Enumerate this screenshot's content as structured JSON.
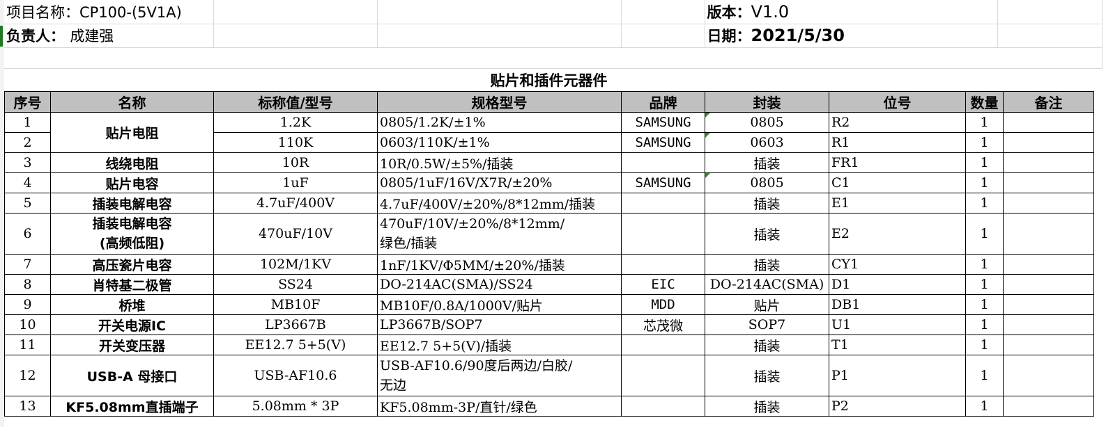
{
  "project": {
    "label": "项目名称：CP100-(5V1A)",
    "version_label": "版本：",
    "version": "V1.0"
  },
  "owner": {
    "label": "负责人：",
    "name": "成建强",
    "date_label": "日期：",
    "date": "2021/5/30"
  },
  "table_title": "贴片和插件元器件",
  "headers": [
    "序号",
    "名称",
    "标称值/型号",
    "规格型号",
    "品牌",
    "封装",
    "位号",
    "数量",
    "备注"
  ],
  "rows": [
    {
      "no": "1",
      "name": "贴片电阻",
      "value": "1.2K",
      "spec": "0805/1.2K/±1%",
      "brand": "SAMSUNG",
      "package": "0805",
      "ref": "R2",
      "qty": "1",
      "note": ""
    },
    {
      "no": "2",
      "name": "",
      "value": "110K",
      "spec": "0603/110K/±1%",
      "brand": "SAMSUNG",
      "package": "0603",
      "ref": "R1",
      "qty": "1",
      "note": ""
    },
    {
      "no": "3",
      "name": "线绕电阻",
      "value": "10R",
      "spec": "10R/0.5W/±5%/插装",
      "brand": "",
      "package": "插装",
      "ref": "FR1",
      "qty": "1",
      "note": ""
    },
    {
      "no": "4",
      "name": "贴片电容",
      "value": "1uF",
      "spec": "0805/1uF/16V/X7R/±20%",
      "brand": "SAMSUNG",
      "package": "0805",
      "ref": "C1",
      "qty": "1",
      "note": ""
    },
    {
      "no": "5",
      "name": "插装电解电容",
      "value": "4.7uF/400V",
      "spec": "4.7uF/400V/±20%/8*12mm/插装",
      "brand": "",
      "package": "插装",
      "ref": "E1",
      "qty": "1",
      "note": ""
    },
    {
      "no": "6",
      "name": "插装电解电容",
      "name2": "(高频低阻)",
      "value": "470uF/10V",
      "spec": "470uF/10V/±20%/8*12mm/",
      "spec2": "绿色/插装",
      "brand": "",
      "package": "插装",
      "ref": "E2",
      "qty": "1",
      "note": ""
    },
    {
      "no": "7",
      "name": "高压瓷片电容",
      "value": "102M/1KV",
      "spec": "1nF/1KV/Φ5MM/±20%/插装",
      "brand": "",
      "package": "插装",
      "ref": "CY1",
      "qty": "1",
      "note": ""
    },
    {
      "no": "8",
      "name": "肖特基二极管",
      "value": "SS24",
      "spec": "DO-214AC(SMA)/SS24",
      "brand": "EIC",
      "package": "DO-214AC(SMA)",
      "ref": "D1",
      "qty": "1",
      "note": ""
    },
    {
      "no": "9",
      "name": "桥堆",
      "value": "MB10F",
      "spec": "MB10F/0.8A/1000V/贴片",
      "brand": "MDD",
      "package": "贴片",
      "ref": "DB1",
      "qty": "1",
      "note": ""
    },
    {
      "no": "10",
      "name": "开关电源IC",
      "value": "LP3667B",
      "spec": "LP3667B/SOP7",
      "brand": "芯茂微",
      "package": "SOP7",
      "ref": "U1",
      "qty": "1",
      "note": ""
    },
    {
      "no": "11",
      "name": "开关变压器",
      "value": "EE12.7 5+5(V)",
      "spec": "EE12.7 5+5(V)/插装",
      "brand": "",
      "package": "插装",
      "ref": "T1",
      "qty": "1",
      "note": ""
    },
    {
      "no": "12",
      "name": "USB-A 母接口",
      "value": "USB-AF10.6",
      "spec": "USB-AF10.6/90度后两边/白胶/",
      "spec2": "无边",
      "brand": "",
      "package": "插装",
      "ref": "P1",
      "qty": "1",
      "note": ""
    },
    {
      "no": "13",
      "name": "KF5.08mm直插端子",
      "value": "5.08mm * 3P",
      "spec": "KF5.08mm-3P/直针/绿色",
      "brand": "",
      "package": "插装",
      "ref": "P2",
      "qty": "1",
      "note": ""
    }
  ]
}
